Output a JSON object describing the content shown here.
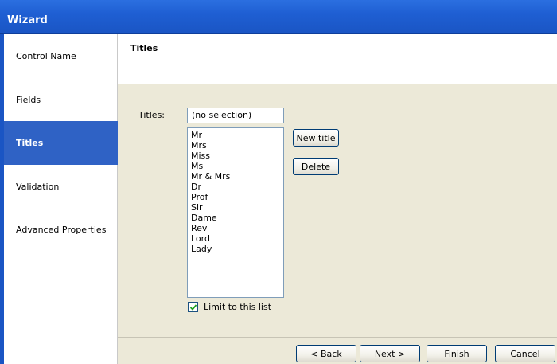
{
  "window": {
    "title": "Wizard"
  },
  "sidebar": {
    "items": [
      {
        "label": "Control Name",
        "active": false
      },
      {
        "label": "Fields",
        "active": false
      },
      {
        "label": "Titles",
        "active": true
      },
      {
        "label": "Validation",
        "active": false
      },
      {
        "label": "Advanced Properties",
        "active": false
      }
    ]
  },
  "page": {
    "title": "Titles"
  },
  "titles_field": {
    "label": "Titles:",
    "selection": "(no selection)",
    "options": [
      "Mr",
      "Mrs",
      "Miss",
      "Ms",
      "Mr & Mrs",
      "Dr",
      "Prof",
      "Sir",
      "Dame",
      "Rev",
      "Lord",
      "Lady"
    ]
  },
  "actions": {
    "new_title": "New title",
    "delete": "Delete"
  },
  "limit": {
    "label": "Limit to this list",
    "checked": true
  },
  "footer": {
    "back": "< Back",
    "next": "Next >",
    "finish": "Finish",
    "cancel": "Cancel"
  },
  "colors": {
    "titlebar": "#1f5fd3",
    "active_item": "#2f62c5",
    "panel": "#ece9d8"
  }
}
